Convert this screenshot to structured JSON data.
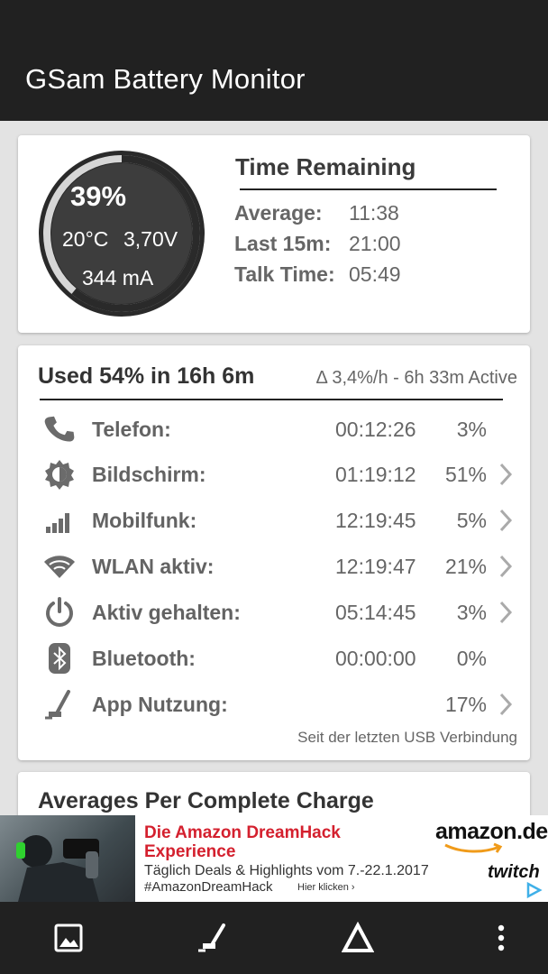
{
  "app": {
    "title": "GSam Battery Monitor"
  },
  "gauge": {
    "percent": "39%",
    "level": 0.39,
    "temperature": "20°C",
    "voltage": "3,70V",
    "current": "344 mA"
  },
  "time_remaining": {
    "title": "Time Remaining",
    "rows": [
      {
        "label": "Average:",
        "value": "11:38"
      },
      {
        "label": "Last 15m:",
        "value": "21:00"
      },
      {
        "label": "Talk Time:",
        "value": "05:49"
      }
    ]
  },
  "usage": {
    "title": "Used 54% in 16h 6m",
    "rate": "Δ 3,4%/h - 6h 33m Active",
    "rows": [
      {
        "icon": "phone-icon",
        "label": "Telefon:",
        "time": "00:12:26",
        "percent": "3%",
        "chevron": false
      },
      {
        "icon": "brightness-icon",
        "label": "Bildschirm:",
        "time": "01:19:12",
        "percent": "51%",
        "chevron": true
      },
      {
        "icon": "signal-bars-icon",
        "label": "Mobilfunk:",
        "time": "12:19:45",
        "percent": "5%",
        "chevron": true
      },
      {
        "icon": "wifi-icon",
        "label": "WLAN aktiv:",
        "time": "12:19:47",
        "percent": "21%",
        "chevron": true
      },
      {
        "icon": "power-icon",
        "label": "Aktiv gehalten:",
        "time": "05:14:45",
        "percent": "3%",
        "chevron": true
      },
      {
        "icon": "bluetooth-icon",
        "label": "Bluetooth:",
        "time": "00:00:00",
        "percent": "0%",
        "chevron": false
      },
      {
        "icon": "app-usage-icon",
        "label": "App Nutzung:",
        "time": "",
        "percent": "17%",
        "chevron": true
      }
    ],
    "footnote": "Seit der letzten USB Verbindung"
  },
  "averages": {
    "title": "Averages Per Complete Charge"
  },
  "ad": {
    "headline_1": "Die Amazon DreamHack",
    "headline_2": "Experience",
    "line_1": "Täglich Deals & Highlights vom 7.-22.1.2017",
    "line_2": "#AmazonDreamHack",
    "cta": "Hier klicken ›",
    "brand_1": "amazon.de",
    "brand_2": "twitch"
  },
  "navbar": {
    "buttons": [
      "image-icon",
      "app-usage-icon",
      "delta-icon",
      "more-vert-icon"
    ]
  },
  "colors": {
    "bar": "#212121",
    "gauge_fill": "#3d3d3d",
    "ad_red": "#d4202e"
  }
}
